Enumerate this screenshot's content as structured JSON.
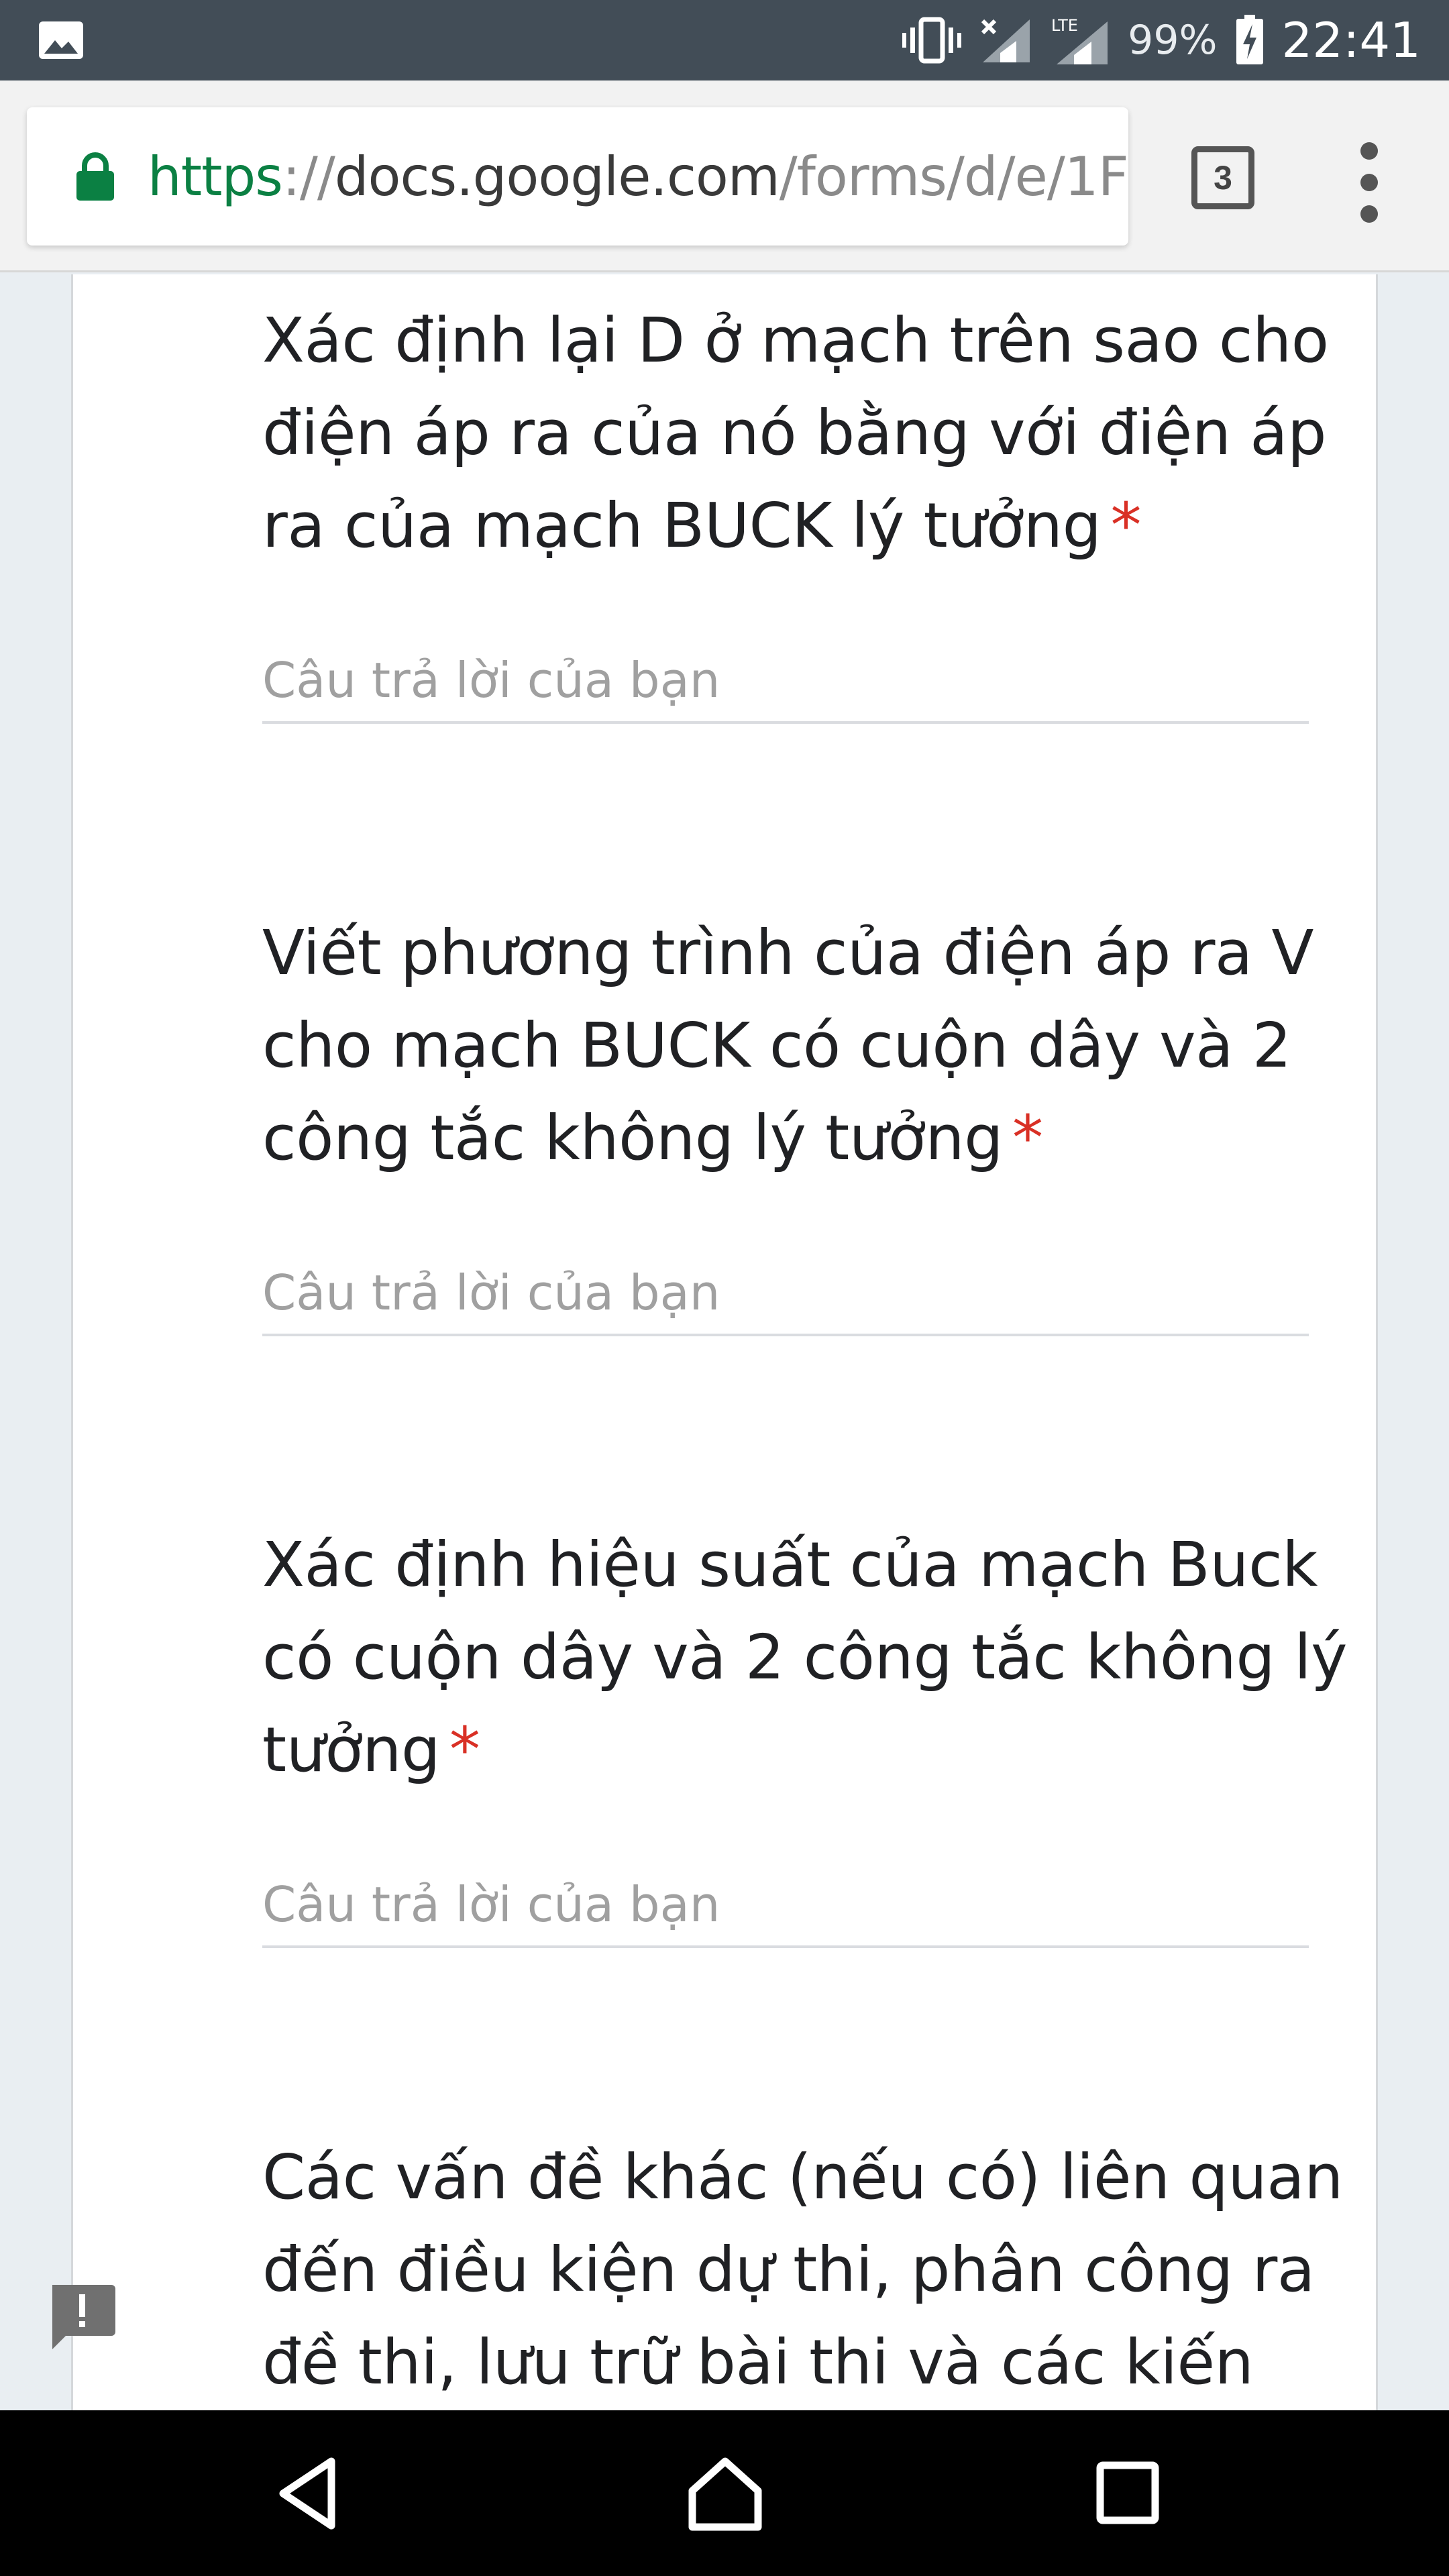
{
  "status_bar": {
    "battery_percent": "99%",
    "time": "22:41",
    "network_label": "LTE",
    "icons": [
      "image-notification-icon",
      "vibrate-icon",
      "signal-icon",
      "lte-signal-icon",
      "battery-charging-icon"
    ]
  },
  "browser": {
    "url": {
      "scheme": "https",
      "separator": "://",
      "host": "docs.google.com",
      "path": "/forms/d/e/1F"
    },
    "tab_count": "3"
  },
  "form": {
    "required_marker": "*",
    "questions": [
      {
        "title": "Xác định lại D ở mạch trên sao cho điện áp ra của nó bằng với điện áp ra của mạch BUCK lý tưởng",
        "placeholder": "Câu trả lời của bạn"
      },
      {
        "title": "Viết phương trình của điện áp ra V cho mạch BUCK có cuộn dây và 2 công tắc không lý tưởng",
        "placeholder": "Câu trả lời của bạn"
      },
      {
        "title": "Xác định hiệu suất của mạch Buck có cuộn dây và 2 công tắc không lý tưởng",
        "placeholder": "Câu trả lời của bạn"
      },
      {
        "title": "Các vấn đề khác (nếu có) liên quan đến điều kiện dự thi, phân công ra đề thi, lưu trữ bài thi và các kiến"
      }
    ]
  },
  "colors": {
    "status_bar": "#424d57",
    "url_scheme": "#0b8043",
    "required": "#d93025",
    "nav_bar": "#000000"
  }
}
